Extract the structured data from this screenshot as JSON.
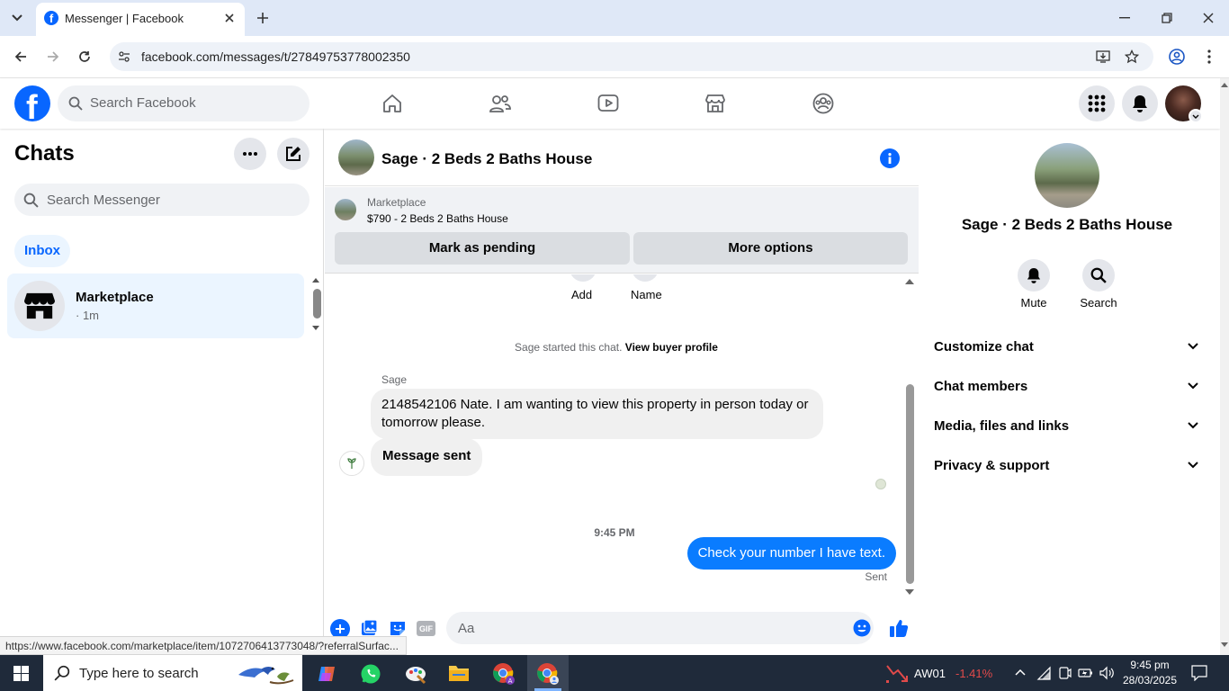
{
  "browser": {
    "tab_title": "Messenger | Facebook",
    "url": "facebook.com/messages/t/27849753778002350",
    "status_url": "https://www.facebook.com/marketplace/item/1072706413773048/?referralSurfac..."
  },
  "fb": {
    "search_placeholder": "Search Facebook"
  },
  "chats": {
    "title": "Chats",
    "search_placeholder": "Search Messenger",
    "inbox_label": "Inbox",
    "items": [
      {
        "name": "Marketplace",
        "time": "· 1m"
      }
    ]
  },
  "conversation": {
    "title": "Sage · 2 Beds 2 Baths House",
    "listing_source": "Marketplace",
    "listing_title": "$790 - 2 Beds 2 Baths House",
    "mark_pending": "Mark as pending",
    "more_options": "More options",
    "quick_add": "Add",
    "quick_name": "Name",
    "started_text": "Sage started this chat.",
    "buyer_profile_link": "View buyer profile",
    "sender_name": "Sage",
    "messages": [
      {
        "text": "2148542106 Nate.  I am wanting to view this property in person today or tomorrow please."
      },
      {
        "text": "Message sent"
      }
    ],
    "timestamp": "9:45 PM",
    "outgoing": "Check your number I have text.",
    "sent_status": "Sent",
    "composer_placeholder": "Aa"
  },
  "details": {
    "title": "Sage · 2 Beds 2 Baths House",
    "mute_label": "Mute",
    "search_label": "Search",
    "sections": [
      "Customize chat",
      "Chat members",
      "Media, files and links",
      "Privacy & support"
    ]
  },
  "taskbar": {
    "search_placeholder": "Type here to search",
    "stock_name": "AW01",
    "stock_change": "-1.41%",
    "time": "9:45 pm",
    "date": "28/03/2025"
  },
  "colors": {
    "fb_blue": "#0866ff",
    "bubble_out": "#0a7cff",
    "stock_red": "#e04a4a"
  }
}
